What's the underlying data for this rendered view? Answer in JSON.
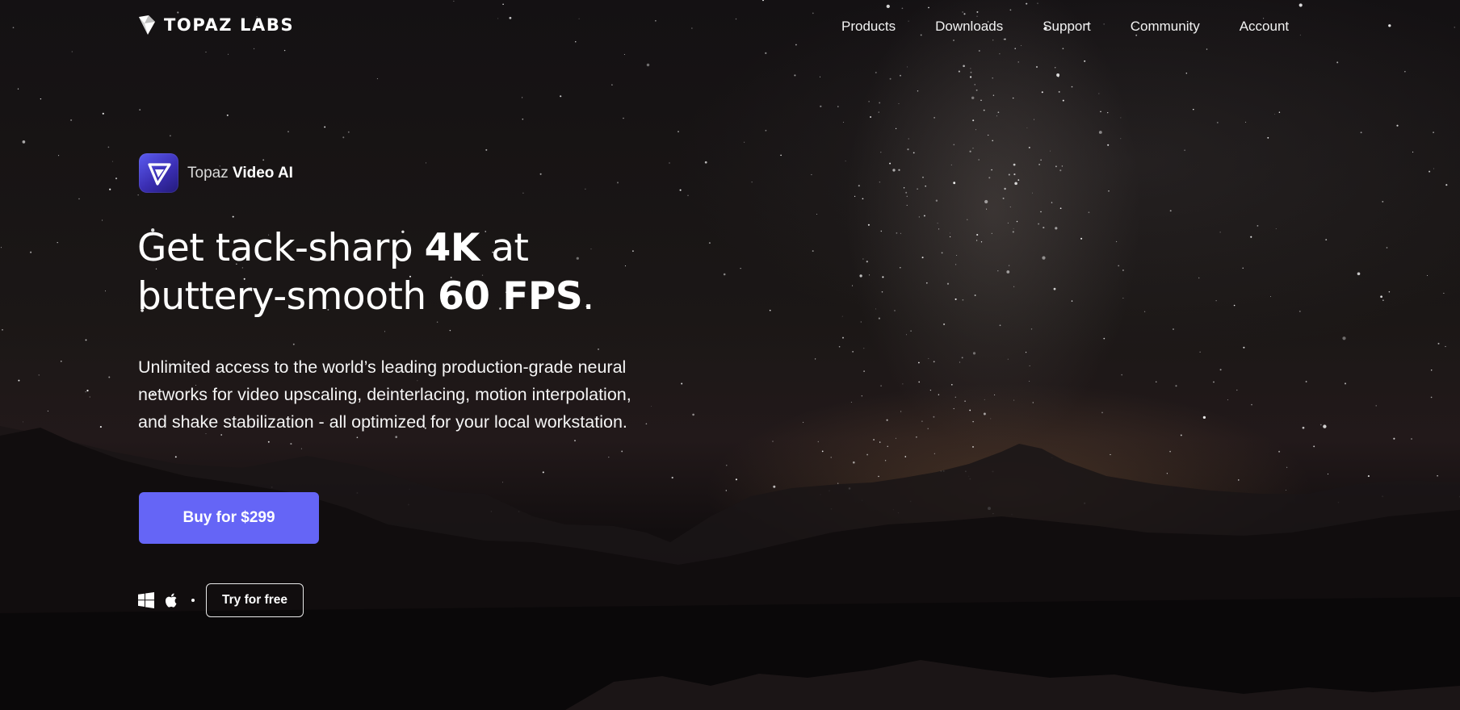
{
  "brand": {
    "logo_text": "TOPAZ LABS",
    "logo_icon": "topaz-gem-icon"
  },
  "nav": {
    "items": [
      {
        "label": "Products"
      },
      {
        "label": "Downloads"
      },
      {
        "label": "Support"
      },
      {
        "label": "Community"
      },
      {
        "label": "Account"
      }
    ]
  },
  "product": {
    "brand_word": "Topaz",
    "name": "Video AI",
    "icon": "video-ai-play-icon"
  },
  "hero": {
    "headline_line1_prefix": "Get tack-sharp ",
    "headline_line1_bold": "4K",
    "headline_line1_suffix": " at",
    "headline_line2_prefix": "buttery-smooth ",
    "headline_line2_bold": "60 FPS",
    "headline_line2_suffix": ".",
    "description": "Unlimited access to the world’s leading production-grade neural networks for video upscaling, deinterlacing, motion interpolation, and shake stabilization - all optimized for your local workstation."
  },
  "cta": {
    "buy_label": "Buy for $299",
    "try_label": "Try for free",
    "platforms": [
      "windows-icon",
      "apple-icon"
    ]
  },
  "colors": {
    "accent": "#6565f6",
    "product_icon_gradient_start": "#5b5cf0",
    "product_icon_gradient_end": "#231a7a",
    "background": "#0c0a0b"
  }
}
